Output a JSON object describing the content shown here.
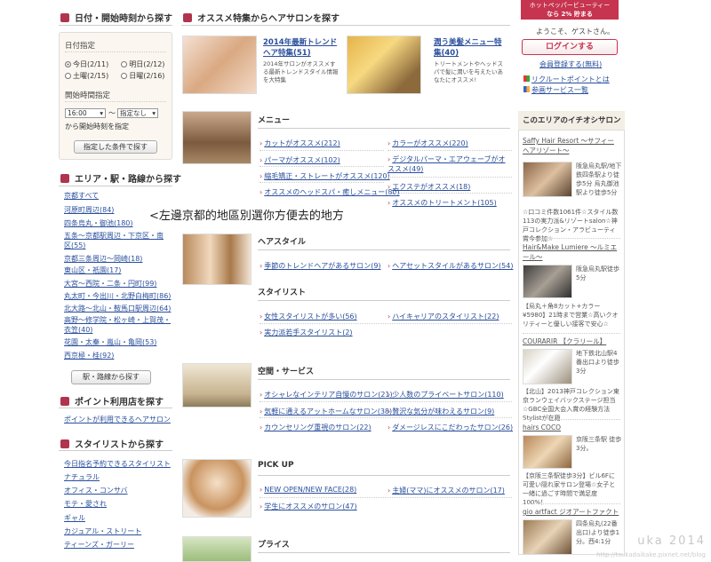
{
  "left": {
    "date_section_title": "日付・開始時刻から探す",
    "date_label": "日付指定",
    "dates": [
      {
        "label": "今日(2/11)",
        "checked": true
      },
      {
        "label": "明日(2/12)",
        "checked": false
      },
      {
        "label": "土曜(2/15)",
        "checked": false
      },
      {
        "label": "日曜(2/16)",
        "checked": false
      }
    ],
    "time_label": "開始時間指定",
    "time_from": "16:00",
    "time_tilde": "〜",
    "time_to": "指定なし",
    "time_note": "から開始時刻を指定",
    "search_button": "指定した条件で探す",
    "area_section_title": "エリア・駅・路線から探す",
    "areas": [
      "京都すべて",
      "河原町周辺(84)",
      "四条烏丸・御池(180)",
      "五条〜京都駅周辺・下京区・南区(55)",
      "京都三条周辺〜岡崎(18)",
      "東山区・祇園(17)",
      "大宮〜西院・二条・円町(99)",
      "丸太町・今出川・北野白梅町(86)",
      "北大路〜北山・鞍馬口駅周辺(64)",
      "高野〜修学院・松ヶ崎・上賀茂・衣笠(40)",
      "花園・太秦・嵐山・亀岡(53)",
      "西京極・桂(92)"
    ],
    "area_button": "駅・路線から探す",
    "point_section_title": "ポイント利用店を探す",
    "point_link": "ポイントが利用できるヘアサロン",
    "stylist_section_title": "スタイリストから探す",
    "stylist_links": [
      "今日指名予約できるスタイリスト",
      "ナチュラル",
      "オフィス・コンサバ",
      "モテ・愛され",
      "ギャル",
      "カジュアル・ストリート",
      "ティーンズ・ガーリー"
    ]
  },
  "middle": {
    "feature_title": "オススメ特集からヘアサロンを探す",
    "features": [
      {
        "title": "2014年最新トレンドヘア特集(51)",
        "desc": "2014年サロンがオススメする最新トレンドスタイル情報を大特集"
      },
      {
        "title": "潤う美髪メニュー特集(40)",
        "desc": "トリートメントやヘッドスパで髪に潤いを与えたいあなたにオススメ!"
      }
    ],
    "menu_head": "メニュー",
    "menu_left": [
      "カットがオススメ(212)",
      "パーマがオススメ(102)",
      "縮毛矯正・ストレートがオススメ(120)",
      "オススメのヘッドスパ・癒しメニュー(80)"
    ],
    "menu_right": [
      "カラーがオススメ(220)",
      "デジタルパーマ・エアウェーブがオススメ(49)",
      "エクステがオススメ(18)",
      "オススメのトリートメント(105)"
    ],
    "hair_head": "ヘアスタイル",
    "hair_left": "季節のトレンドヘアがあるサロン(9)",
    "hair_right": "ヘアセットスタイルがあるサロン(54)",
    "stylist_head": "スタイリスト",
    "stylist_left": [
      "女性スタイリストが多い(56)",
      "実力派若手スタイリスト(2)"
    ],
    "stylist_right": "ハイキャリアのスタイリスト(22)",
    "space_head": "空間・サービス",
    "space_left": [
      "オシャレなインテリア自慢のサロン(21)",
      "気軽に通えるアットホームなサロン(38)",
      "カウンセリング重視のサロン(22)"
    ],
    "space_right": [
      "少人数のプライベートサロン(110)",
      "贅沢な気分が味わえるサロン(9)",
      "ダメージレスにこだわったサロン(26)"
    ],
    "pickup_head": "PICK UP",
    "pickup_left": [
      "NEW OPEN/NEW FACE(28)",
      "学生にオススメのサロン(47)"
    ],
    "pickup_right": "主婦(ママ)にオススメのサロン(17)",
    "price_head": "プライス",
    "annotation": "<左邊京都的地區別選你方便去的地方"
  },
  "right": {
    "promo_line1": "ホットペッパービューティー",
    "promo_line2": "なら 2% 貯まる",
    "welcome": "ようこそ、ゲストさん。",
    "login_button": "ログインする",
    "register_link": "会員登録する(無料)",
    "recruit_link": "リクルートポイントとは",
    "service_link": "参画サービス一覧",
    "section_title": "このエリアのイチオシサロン",
    "salons": [
      {
        "name": "Saffy Hair Resort ～サフィーヘアリゾート～",
        "access": "阪急烏丸駅/地下鉄四条駅より徒歩5分 烏丸御池駅より徒歩5分",
        "desc": "☆口コミ件数1061件☆スタイル数113の実力派&リゾートsalon☆神戸コレクション・アラビューティ賞今参加☆"
      },
      {
        "name": "Hair&Make Lumiere ～ルミエール～",
        "access": "阪急烏丸駅徒歩5分",
        "desc": "【烏丸＋角8カット+カラー¥5980】21時まで営業☆高いクオリティーと優しい接客で安心☆"
      },
      {
        "name": "COURARIR 【クラリール】",
        "access": "地下鉄北山駅4番出口より徒歩3分",
        "desc": "【北山】2013神戸コレクション東京ランウェイバックステージ担当☆GBC全国大会入賞の経験方法Stylistが在籍"
      },
      {
        "name": "hairs COCO",
        "access": "京阪三条駅 徒歩3分。",
        "desc": "【京阪三条駅徒歩3分】ビル6Fに可愛い隠れ家サロン登場☆女子と一緒に過ごす時間で満足度100%！"
      },
      {
        "name": "gio artfact ジオアートファクト",
        "access": "四条烏丸(22番出口)より徒歩1分。西4:1分"
      }
    ]
  },
  "watermark": "uka 2014",
  "watermark_url": "http://tsukadaikake.pixnet.net/blog"
}
